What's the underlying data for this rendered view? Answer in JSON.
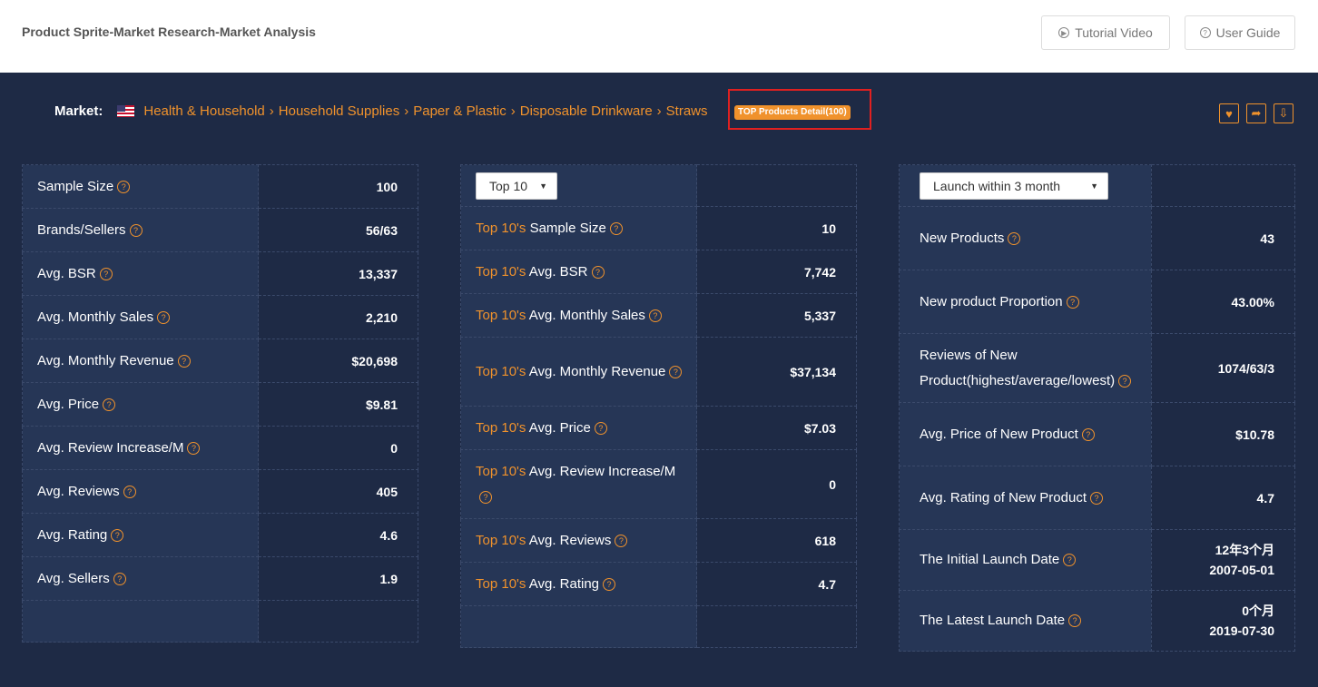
{
  "header": {
    "title": "Product Sprite-Market Research-Market Analysis",
    "tutorial_label": "Tutorial Video",
    "guide_label": "User Guide"
  },
  "market": {
    "label": "Market:",
    "breadcrumbs": [
      "Health & Household",
      "Household Supplies",
      "Paper & Plastic",
      "Disposable Drinkware",
      "Straws"
    ],
    "separator": "›",
    "badge": "TOP Products Detail(100)",
    "icons": [
      "heart-icon",
      "share-icon",
      "download-icon"
    ]
  },
  "overview": {
    "rows": [
      {
        "label": "Sample Size",
        "value": "100"
      },
      {
        "label": "Brands/Sellers",
        "value": "56/63"
      },
      {
        "label": "Avg. BSR",
        "value": "13,337"
      },
      {
        "label": "Avg. Monthly Sales",
        "value": "2,210"
      },
      {
        "label": "Avg. Monthly Revenue",
        "value": "$20,698"
      },
      {
        "label": "Avg. Price",
        "value": "$9.81"
      },
      {
        "label": "Avg. Review Increase/M",
        "value": "0"
      },
      {
        "label": "Avg. Reviews",
        "value": "405"
      },
      {
        "label": "Avg. Rating",
        "value": "4.6"
      },
      {
        "label": "Avg. Sellers",
        "value": "1.9"
      }
    ]
  },
  "top": {
    "select": "Top 10",
    "prefix": "Top 10's",
    "rows": [
      {
        "label": "Sample Size",
        "value": "10"
      },
      {
        "label": "Avg. BSR",
        "value": "7,742"
      },
      {
        "label": "Avg. Monthly Sales",
        "value": "5,337"
      },
      {
        "label": "Avg. Monthly Revenue",
        "value": "$37,134"
      },
      {
        "label": "Avg. Price",
        "value": "$7.03"
      },
      {
        "label": "Avg. Review Increase/M",
        "value": "0"
      },
      {
        "label": "Avg. Reviews",
        "value": "618"
      },
      {
        "label": "Avg. Rating",
        "value": "4.7"
      }
    ]
  },
  "launch": {
    "select": "Launch within 3 month",
    "rows": [
      {
        "label": "New Products",
        "value": "43"
      },
      {
        "label": "New product Proportion",
        "value": "43.00%"
      },
      {
        "label": "Reviews of New Product(highest/average/lowest)",
        "value": "1074/63/3"
      },
      {
        "label": "Avg. Price of New Product",
        "value": "$10.78"
      },
      {
        "label": "Avg. Rating of New Product",
        "value": "4.7"
      },
      {
        "label": "The Initial Launch Date",
        "value": "12年3个月",
        "value2": "2007-05-01"
      },
      {
        "label": "The Latest Launch Date",
        "value": "0个月",
        "value2": "2019-07-30"
      }
    ]
  },
  "colors": {
    "accent": "#f0922c",
    "background": "#1e2a45",
    "panel": "#263656",
    "highlight": "#e02020"
  }
}
